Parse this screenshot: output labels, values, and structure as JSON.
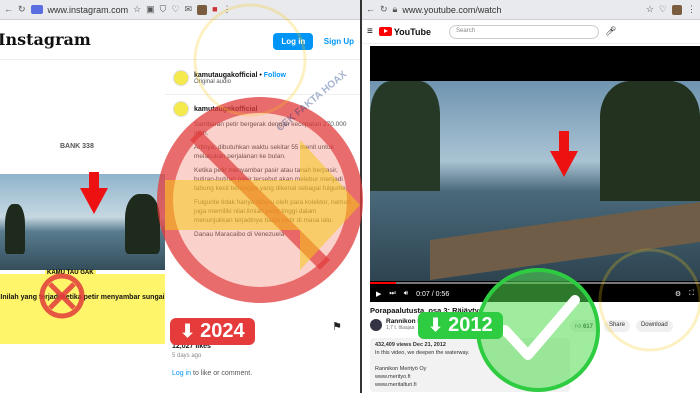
{
  "left_browser": {
    "url": "www.instagram.com",
    "logo": "Instagram",
    "login_label": "Log in",
    "signup_label": "Sign Up",
    "post": {
      "username": "kamutaugakofficial",
      "follow_label": "Follow",
      "audio": "Original audio",
      "caption_user": "kamutaugakofficial",
      "caption_lines": [
        "Sambaran petir bergerak dengan kecepatan 270.000 mph.",
        "Artinya, dibutuhkan waktu sekitar 55 menit untuk melakukan perjalanan ke bulan.",
        "Ketika petir menyambar pasir atau tanah berpasir, butiran-butiran pasir tersebut akan melebur menjadi tabung kecil berongga yang dikenal sebagai fulgurite.",
        "Fulgurite tidak hanya diburu oleh para kolektor, namun juga memiliki nilai ilmiah yang tinggi dalam menunjukkan terjadinya badai petir di masa lalu.",
        "Danau Maracaibo di Venezuela"
      ],
      "watermark": "BANK 338",
      "image_banner": "KAMU TAU GAK",
      "image_caption": "Inilah yang terjadi ketika petir menyambar sungai",
      "likes": "12,027 likes",
      "ago": "5 days ago",
      "login_link": "Log in",
      "comment_text": "to like or comment."
    }
  },
  "right_browser": {
    "url": "www.youtube.com/watch",
    "logo": "YouTube",
    "search_placeholder": "Search",
    "time": "0:07 / 0:56",
    "video_title": "Porapaalutusta, osa 3: Räjäytys",
    "channel": "Rannikon Merityö Oy",
    "subscribers": "1,7 t. tilaajaa",
    "likes": "617",
    "share_label": "Share",
    "download_label": "Download",
    "desc_stats": "432,409 views  Dec 21, 2012",
    "desc_line": "In this video, we deepen the waterway.",
    "desc_company": "Rannikon Merityö Oy",
    "desc_url1": "www.merityo.fi",
    "desc_url2": "www.meritalturi.fi"
  },
  "overlay": {
    "year_wrong": "2024",
    "year_right": "2012",
    "brand_watermark": "CEK FAKTA HOAX",
    "colors": {
      "wrong": "#e63b3b",
      "right": "#2ecc40",
      "hoax_ring": "#e23b3b",
      "badge_yellow": "#f6c915"
    }
  }
}
